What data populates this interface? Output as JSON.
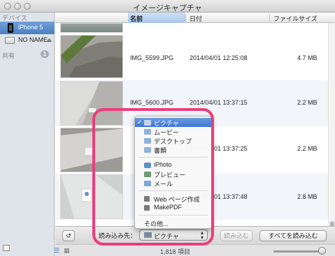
{
  "window": {
    "title": "イメージキャプチャ"
  },
  "sidebar": {
    "devices_header": "デバイス",
    "devices": [
      {
        "label": "iPhone 5",
        "icon": "iphone-icon",
        "selected": true
      },
      {
        "label": "NO NAME",
        "icon": "drive-icon",
        "eject": "⏏"
      }
    ],
    "shared_header": "共有",
    "shared_count": "1"
  },
  "columns": {
    "name": "名前",
    "date": "日付",
    "size": "ファイルサイズ"
  },
  "rows": [
    {
      "name": "IMG_5599.JPG",
      "date": "2014/04/01 12:25:08",
      "size": "4.7 MB"
    },
    {
      "name": "IMG_5600.JPG",
      "date": "2014/04/01 13:37:15",
      "size": "2.2 MB"
    },
    {
      "name": "",
      "date": "2014/04/01 13:37:25",
      "size": "2.2 MB"
    },
    {
      "name": "",
      "date": "2014/04/01 13:37:48",
      "size": "2.8 MB"
    }
  ],
  "toolbar": {
    "rotate": "↺",
    "import_label": "読み込み先：",
    "destination": "ピクチャ",
    "import_button": "読み込む",
    "import_all_button": "すべてを読み込む"
  },
  "status": {
    "count": "1,818 項目"
  },
  "menu": {
    "checkmark": "✓",
    "group1": [
      {
        "label": "ピクチャ",
        "icon": "folder-icon",
        "selected": true
      },
      {
        "label": "ムービー",
        "icon": "folder-icon"
      },
      {
        "label": "デスクトップ",
        "icon": "folder-icon"
      },
      {
        "label": "書類",
        "icon": "folder-icon"
      }
    ],
    "group2": [
      {
        "label": "iPhoto",
        "icon": "iphoto-icon"
      },
      {
        "label": "プレビュー",
        "icon": "preview-icon"
      },
      {
        "label": "メール",
        "icon": "mail-icon"
      }
    ],
    "group3": [
      {
        "label": "Web ページ作成",
        "icon": "automator-icon"
      },
      {
        "label": "MakePDF",
        "icon": "automator-icon"
      }
    ],
    "other": "その他..."
  },
  "colors": {
    "highlight": "#ec3d7b",
    "selection": "#4a7fc0"
  }
}
